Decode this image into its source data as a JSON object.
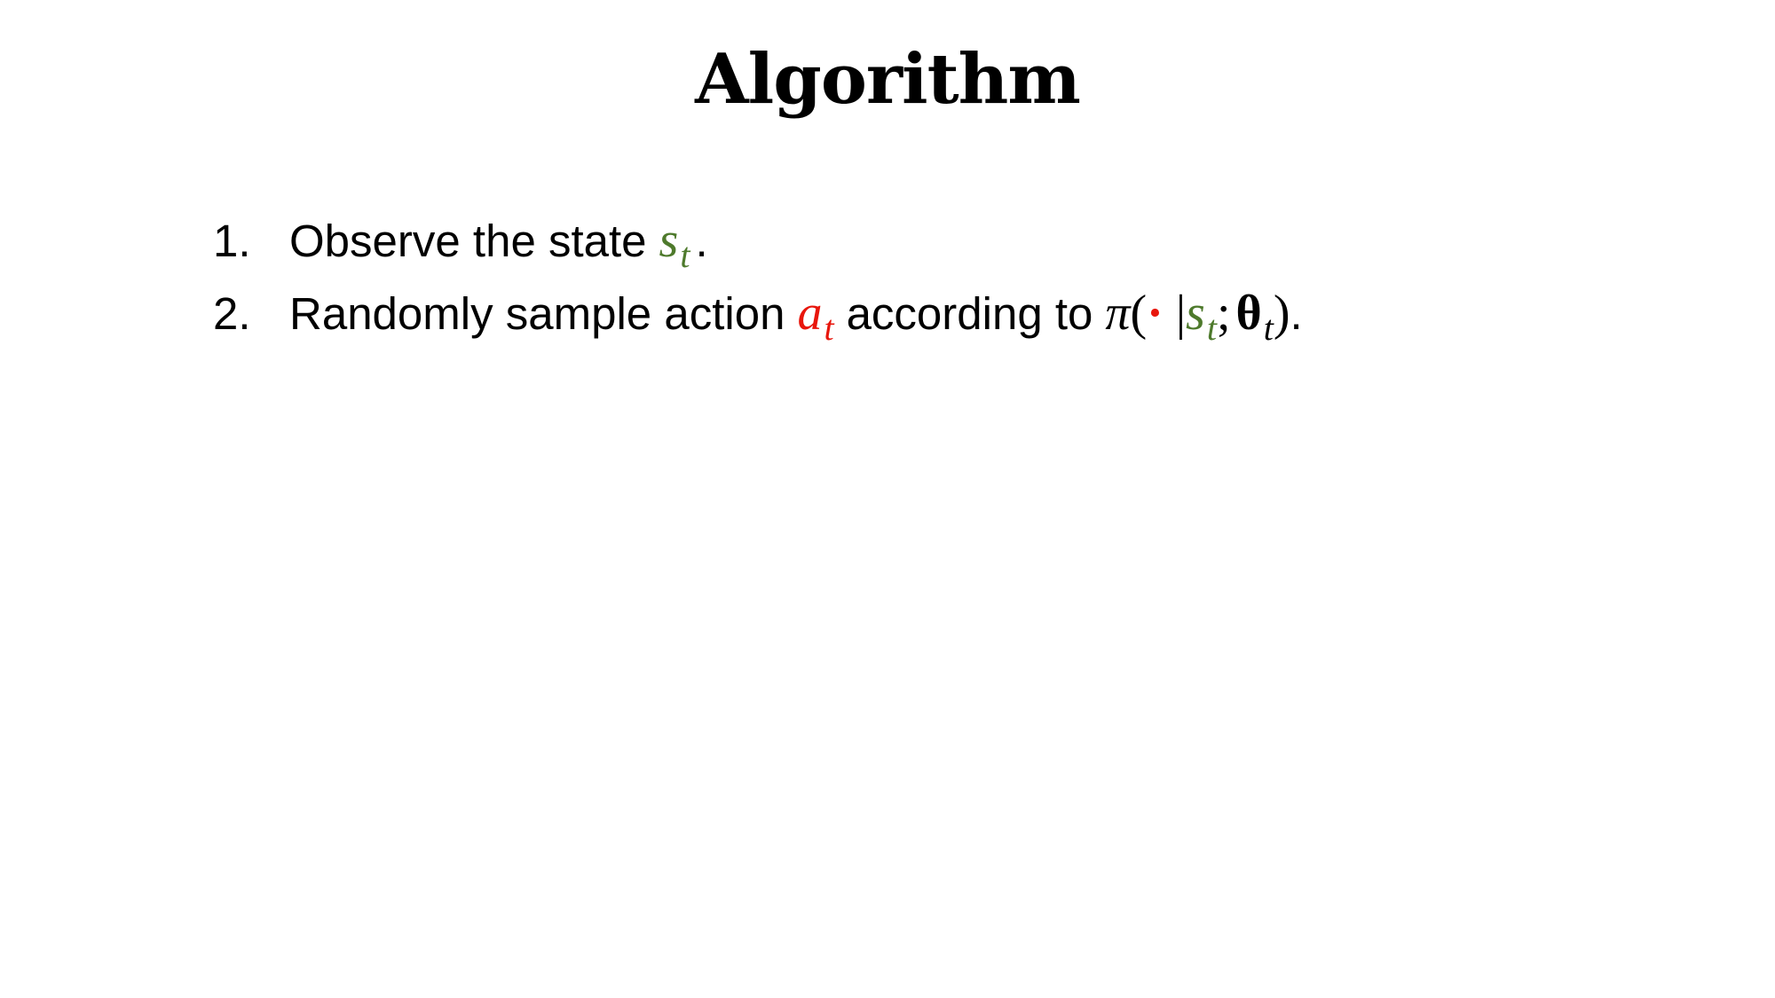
{
  "slide": {
    "title": "Algorithm",
    "colors": {
      "state": "#4e7a2c",
      "action": "#e8160c",
      "text": "#000000",
      "background": "#ffffff"
    },
    "steps": [
      {
        "number": "1.",
        "text": "Observe the state",
        "state_symbol": "s",
        "subscript": "t",
        "end": "."
      },
      {
        "number": "2.",
        "text_before": "Randomly sample action",
        "action_symbol": "a",
        "action_subscript": "t",
        "text_after": "according to",
        "policy_symbol": "π",
        "open_paren": "(",
        "dot": "·",
        "bar": "|",
        "state_symbol": "s",
        "state_subscript": "t",
        "semicolon": ";",
        "theta_symbol": "θ",
        "theta_subscript": "t",
        "close_paren": ")",
        "end": "."
      }
    ]
  }
}
